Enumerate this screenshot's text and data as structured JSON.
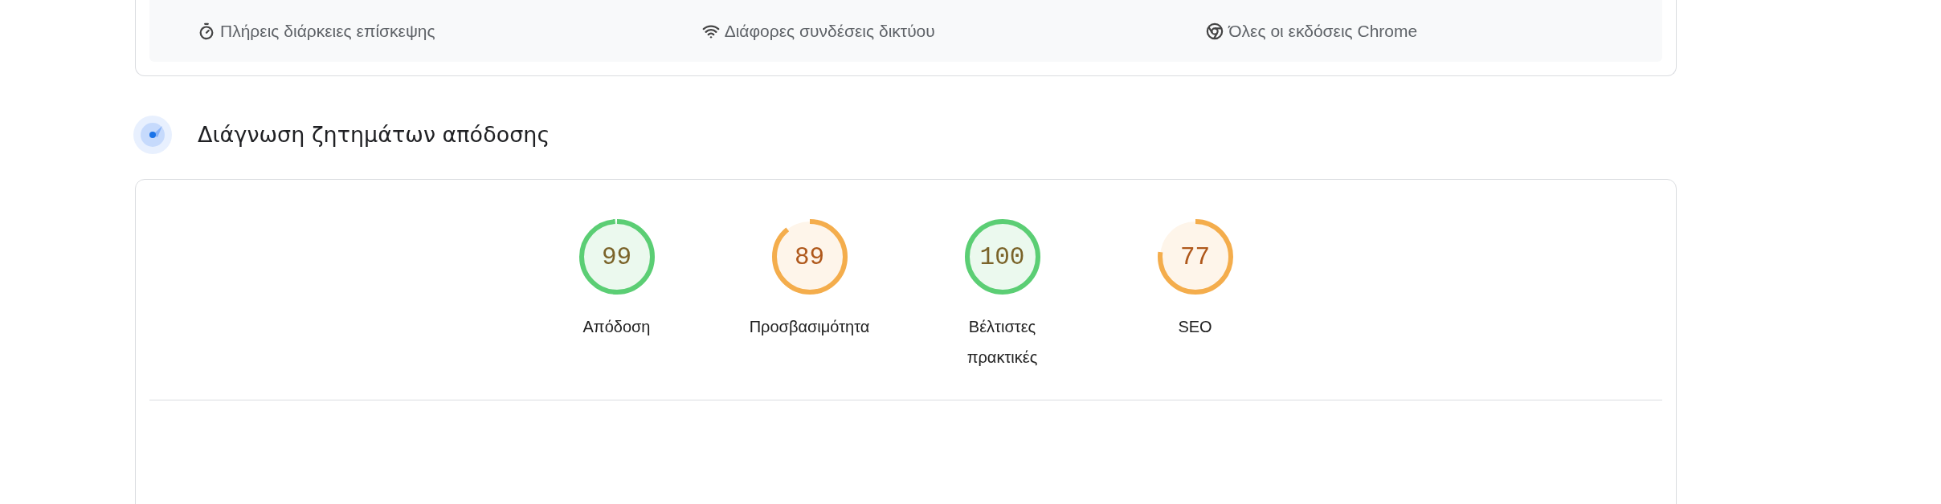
{
  "features": [
    {
      "kind": "timer",
      "label": "Πλήρεις διάρκειες επίσκεψης"
    },
    {
      "kind": "network",
      "label": "Διάφορες συνδέσεις δικτύου"
    },
    {
      "kind": "browser",
      "label": "Όλες οι εκδόσεις Chrome"
    }
  ],
  "section": {
    "title": "Διάγνωση ζητημάτων απόδοσης"
  },
  "gauges": [
    {
      "score": "99",
      "level": 0.99,
      "color": "#5bce74",
      "label": "Απόδοση"
    },
    {
      "score": "89",
      "level": 0.89,
      "color": "#f4ad4c",
      "label": "Προσβασιμότητα"
    },
    {
      "score": "100",
      "level": 1.0,
      "color": "#5bce74",
      "label": "Βέλτιστες πρακτικές"
    },
    {
      "score": "77",
      "level": 0.77,
      "color": "#f4ad4c",
      "label": "SEO"
    }
  ]
}
